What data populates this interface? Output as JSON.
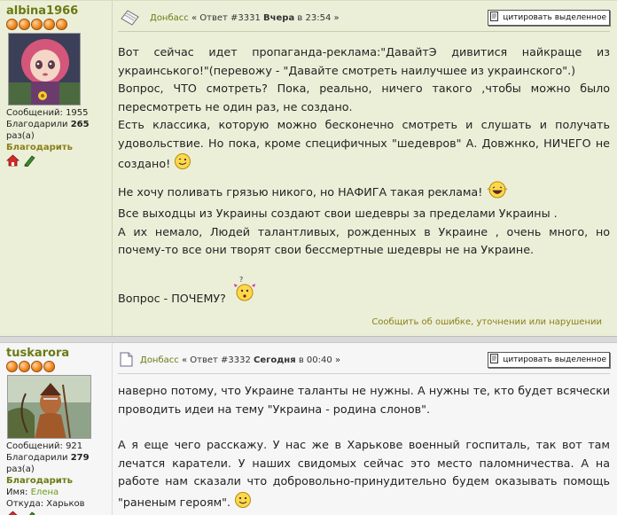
{
  "posts": [
    {
      "username": "albina1966",
      "stats": {
        "messages_label": "Сообщений:",
        "messages": "1955",
        "thanked_label": "Благодарили",
        "thanked": "265",
        "times": "раз(а)"
      },
      "thank_label": "Благодарить",
      "header": {
        "forum": "Донбасс",
        "reply": "« Ответ #3331",
        "day": "Вчера",
        "at": "в",
        "time": "23:54",
        "end": "»"
      },
      "quote_label": "цитировать выделенное",
      "paragraphs": [
        "Вот сейчас идет пропаганда-реклама:\"ДавайтЭ дивитися найкраще из украинського!\"(перевожу - \"Давайте смотреть наилучшее из украинского\".)",
        "Вопрос, ЧТО смотреть? Пока, реально, ничего такого ,чтобы можно было пересмотреть не один раз, не создано.",
        "Есть классика, которую можно бесконечно смотреть и слушать и получать удовольствие. Но пока, кроме специфичных \"шедевров\" А. Довжнко, НИЧЕГО не создано!",
        "Не хочу поливать грязью никого, но НАФИГА такая реклама!",
        "Все выходцы из Украины создают свои шедевры за пределами Украины .",
        "А их немало, Людей талантливых, рожденных в Украине , очень много, но почему-то все они творят свои бессмертные шедевры не на Украине.",
        "Вопрос - ПОЧЕМУ?"
      ],
      "report_label": "Сообщить об ошибке, уточнении или нарушении"
    },
    {
      "username": "tuskarora",
      "stats": {
        "messages_label": "Сообщений:",
        "messages": "921",
        "thanked_label": "Благодарили",
        "thanked": "279",
        "times": "раз(а)",
        "name_label": "Имя:",
        "name": "Елена",
        "from_label": "Откуда:",
        "from": "Харьков"
      },
      "thank_label": "Благодарить",
      "header": {
        "forum": "Донбасс",
        "reply": "« Ответ #3332",
        "day": "Сегодня",
        "at": "в",
        "time": "00:40",
        "end": "»"
      },
      "quote_label": "цитировать выделенное",
      "paragraphs": [
        "наверно потому, что Украине таланты не нужны. А нужны те, кто будет всячески проводить идеи на тему \"Украина - родина слонов\".",
        "А я еще чего расскажу. У нас же в Харькове военный госпиталь, так вот там лечатся каратели. У наших свидомых сейчас это место паломничества. А на работе нам сказали что добровольно-принудительно будем оказывать помощь \"раненым героям\"."
      ]
    }
  ],
  "icons": {
    "post_icon_1": "post-icon",
    "post_icon_2": "document-icon",
    "home": "home-icon",
    "pen": "pen-icon",
    "quote": "quote-icon",
    "smiley": "smiley-icon"
  },
  "colors": {
    "post1_bg": "#ecefd8",
    "post2_bg": "#f6f6f6",
    "link": "#6b7a12",
    "report": "#8a7f17"
  }
}
